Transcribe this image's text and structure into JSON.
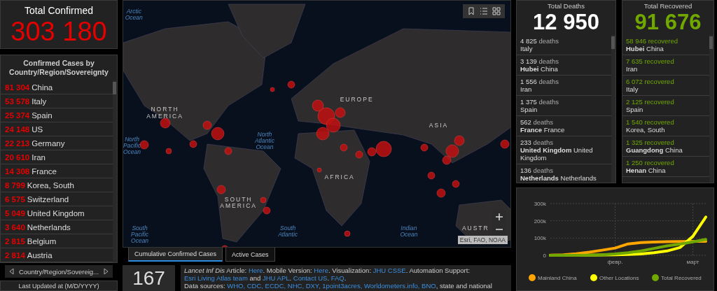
{
  "total_confirmed": {
    "title": "Total Confirmed",
    "value": "303 180"
  },
  "confirmed_by_country": {
    "title": "Confirmed Cases by Country/Region/Sovereignty",
    "rows": [
      {
        "count": "81 304",
        "name": "China"
      },
      {
        "count": "53 578",
        "name": "Italy"
      },
      {
        "count": "25 374",
        "name": "Spain"
      },
      {
        "count": "24 148",
        "name": "US"
      },
      {
        "count": "22 213",
        "name": "Germany"
      },
      {
        "count": "20 610",
        "name": "Iran"
      },
      {
        "count": "14 308",
        "name": "France"
      },
      {
        "count": "8 799",
        "name": "Korea, South"
      },
      {
        "count": "6 575",
        "name": "Switzerland"
      },
      {
        "count": "5 049",
        "name": "United Kingdom"
      },
      {
        "count": "3 640",
        "name": "Netherlands"
      },
      {
        "count": "2 815",
        "name": "Belgium"
      },
      {
        "count": "2 814",
        "name": "Austria"
      }
    ],
    "pager_label": "Country/Region/Sovereig..."
  },
  "last_updated": {
    "label": "Last Updated at (M/D/YYYY)"
  },
  "map": {
    "labels": [
      {
        "text": "Arctic Ocean",
        "kind": "ocean"
      },
      {
        "text": "North Pacific Ocean",
        "kind": "ocean"
      },
      {
        "text": "NORTH AMERICA",
        "kind": "continent"
      },
      {
        "text": "EUROPE",
        "kind": "continent"
      },
      {
        "text": "ASIA",
        "kind": "continent"
      },
      {
        "text": "North Atlantic Ocean",
        "kind": "ocean"
      },
      {
        "text": "AFRICA",
        "kind": "continent"
      },
      {
        "text": "SOUTH AMERICA",
        "kind": "continent"
      },
      {
        "text": "South Pacific Ocean",
        "kind": "ocean"
      },
      {
        "text": "South Atlantic",
        "kind": "ocean"
      },
      {
        "text": "Indian Ocean",
        "kind": "ocean"
      },
      {
        "text": "AUSTR",
        "kind": "continent"
      }
    ],
    "attribution": "Esri, FAO, NOAA"
  },
  "tabs": [
    {
      "label": "Cumulative Confirmed Cases",
      "selected": true
    },
    {
      "label": "Active Cases",
      "selected": false
    }
  ],
  "countries_count": {
    "value": "167"
  },
  "info": {
    "paragraphs": [
      [
        {
          "kind": "text",
          "text": "*Lancet Inf Dis* Article: "
        },
        {
          "kind": "link",
          "text": "Here"
        },
        {
          "kind": "text",
          "text": ". Mobile Version: "
        },
        {
          "kind": "link",
          "text": "Here"
        },
        {
          "kind": "text",
          "text": ". Visualization: "
        },
        {
          "kind": "link",
          "text": "JHU CSSE"
        },
        {
          "kind": "text",
          "text": ". Automation Support: "
        },
        {
          "kind": "link",
          "text": "Esri Living Atlas team"
        },
        {
          "kind": "text",
          "text": " and "
        },
        {
          "kind": "link",
          "text": "JHU APL"
        },
        {
          "kind": "text",
          "text": ". "
        },
        {
          "kind": "link",
          "text": "Contact US"
        },
        {
          "kind": "text",
          "text": ". "
        },
        {
          "kind": "link",
          "text": "FAQ"
        },
        {
          "kind": "text",
          "text": "."
        }
      ],
      [
        {
          "kind": "text",
          "text": "Data sources: "
        },
        {
          "kind": "link",
          "text": "WHO, CDC, ECDC, NHC, DXY, 1point3acres, Worldometers.info, BNO"
        },
        {
          "kind": "text",
          "text": ", state and national"
        }
      ]
    ]
  },
  "total_deaths": {
    "title": "Total Deaths",
    "value": "12 950",
    "items": [
      {
        "count": "4 825",
        "unit": "deaths",
        "place": "Italy"
      },
      {
        "count": "3 139",
        "unit": "deaths",
        "place": "**Hubei** China"
      },
      {
        "count": "1 556",
        "unit": "deaths",
        "place": "Iran"
      },
      {
        "count": "1 375",
        "unit": "deaths",
        "place": "Spain"
      },
      {
        "count": "562",
        "unit": "deaths",
        "place": "**France** France"
      },
      {
        "count": "233",
        "unit": "deaths",
        "place": "**United Kingdom** United Kingdom"
      },
      {
        "count": "136",
        "unit": "deaths",
        "place": "**Netherlands** Netherlands"
      }
    ]
  },
  "total_recovered": {
    "title": "Total Recovered",
    "value": "91 676",
    "items": [
      {
        "count": "58 946",
        "unit": "recovered",
        "place": "**Hubei** China"
      },
      {
        "count": "7 635",
        "unit": "recovered",
        "place": "Iran"
      },
      {
        "count": "6 072",
        "unit": "recovered",
        "place": "Italy"
      },
      {
        "count": "2 125",
        "unit": "recovered",
        "place": "Spain"
      },
      {
        "count": "1 540",
        "unit": "recovered",
        "place": "Korea, South"
      },
      {
        "count": "1 325",
        "unit": "recovered",
        "place": "**Guangdong** China"
      },
      {
        "count": "1 250",
        "unit": "recovered",
        "place": "**Henan** China"
      }
    ]
  },
  "trend": {
    "chart_data": {
      "type": "line",
      "categories": [
        null,
        null,
        null,
        null,
        null,
        "февр.",
        null,
        null,
        null,
        null,
        null,
        "март",
        null
      ],
      "series": [
        {
          "name": "Mainland China",
          "color": "#ffa500",
          "values": [
            1000,
            3000,
            9000,
            18000,
            30000,
            42000,
            66000,
            74000,
            77000,
            79000,
            80000,
            81000,
            81000
          ]
        },
        {
          "name": "Other Locations",
          "color": "#ffff00",
          "values": [
            0,
            0,
            0,
            1000,
            2000,
            3000,
            5000,
            8000,
            15000,
            25000,
            45000,
            110000,
            222000
          ]
        },
        {
          "name": "Total Recovered",
          "color": "#70a800",
          "values": [
            0,
            0,
            0,
            1000,
            3000,
            8000,
            15000,
            25000,
            40000,
            55000,
            65000,
            78000,
            92000
          ]
        }
      ],
      "ylim": [
        0,
        300000
      ],
      "grid": true,
      "legend": true,
      "yticks": [
        {
          "value": 0,
          "label": "0"
        },
        {
          "value": 100000,
          "label": "100k"
        },
        {
          "value": 200000,
          "label": "200k"
        },
        {
          "value": 300000,
          "label": "300k"
        }
      ]
    }
  }
}
